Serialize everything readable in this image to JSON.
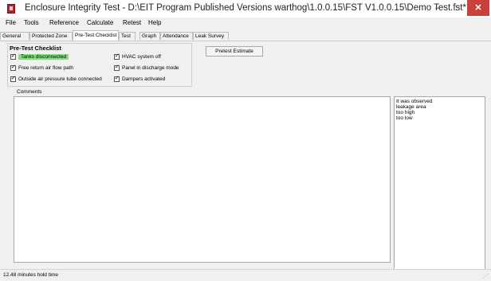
{
  "window": {
    "title": "Enclosure Integrity Test - D:\\EIT Program Published Versions warthog\\1.0.0.15\\FST V1.0.0.15\\Demo Test.fst*",
    "minimize_glyph": "–",
    "maximize_glyph": "□",
    "close_glyph": "✕"
  },
  "menu": {
    "items": [
      "File",
      "Tools",
      "Reference",
      "Calculate",
      "Retest",
      "Help"
    ]
  },
  "tabs": [
    "General",
    "Protected Zone",
    "Pre-Test Checklist",
    "Test",
    "Graph",
    "Attendance",
    "Leak Survey"
  ],
  "active_tab": "Pre-Test Checklist",
  "checklist": {
    "title": "Pre-Test Checklist",
    "left": [
      {
        "label": "Tanks disconnected",
        "checked": true,
        "highlight": "#84e07e"
      },
      {
        "label": "Free return air flow path",
        "checked": true
      },
      {
        "label": "Outside air pressure tube connected",
        "checked": true
      }
    ],
    "right": [
      {
        "label": "HVAC system off",
        "checked": true
      },
      {
        "label": "Panel in discharge mode",
        "checked": true
      },
      {
        "label": "Dampers activated",
        "checked": true
      }
    ]
  },
  "pretest_button": "Pretest Estimate",
  "comments": {
    "label": "Comments",
    "value": ""
  },
  "suggestions": [
    "It was observed",
    "leakage area",
    "too high",
    "too low"
  ],
  "status": {
    "text": "12.48 minutes hold time"
  }
}
